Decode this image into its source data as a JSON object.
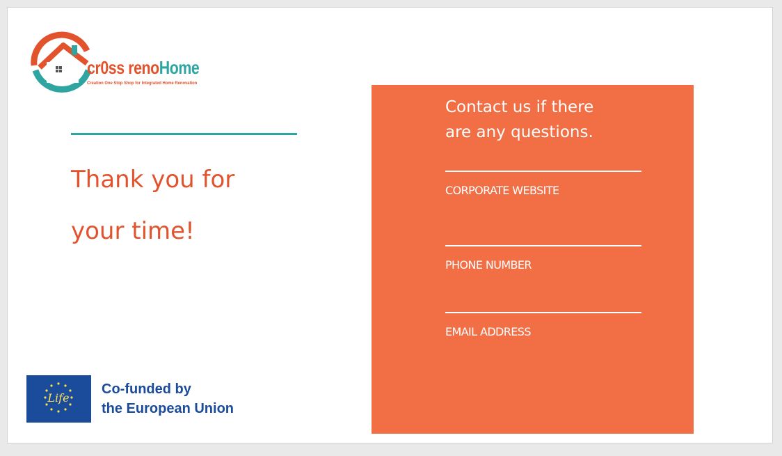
{
  "logo": {
    "wordmark_part1": "cr0ss ",
    "wordmark_part2": "reno",
    "wordmark_part3": "Home",
    "tagline": "Creation One Stop Shop for Integrated Home Renovation",
    "colors": {
      "orange": "#e2532d",
      "teal": "#2ea5a0"
    }
  },
  "main": {
    "thanks_line1": "Thank you for",
    "thanks_line2": "your time!"
  },
  "contact": {
    "heading_line1": "Contact us if there",
    "heading_line2": "are any questions.",
    "fields": [
      {
        "label": "CORPORATE WEBSITE"
      },
      {
        "label": "PHONE NUMBER"
      },
      {
        "label": "EMAIL ADDRESS"
      }
    ],
    "background_color": "#f26e44"
  },
  "funding": {
    "flag_text": "Life",
    "line1": "Co-funded by",
    "line2": "the European Union",
    "color": "#1b4b9b"
  }
}
